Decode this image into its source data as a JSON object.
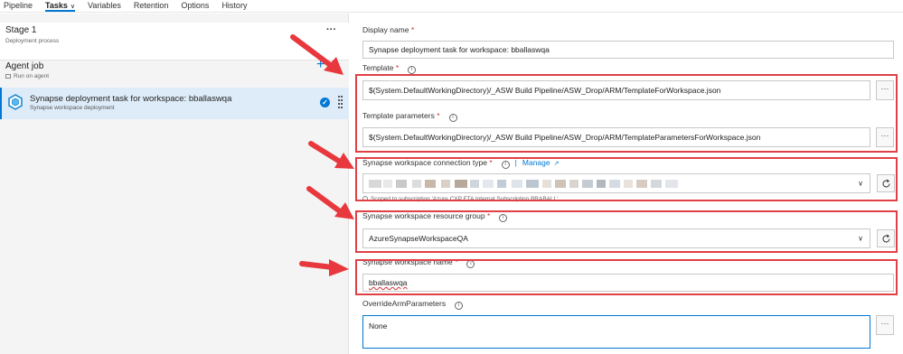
{
  "topnav": {
    "tabs": [
      {
        "label": "Pipeline"
      },
      {
        "label": "Tasks"
      },
      {
        "label": "Variables"
      },
      {
        "label": "Retention"
      },
      {
        "label": "Options"
      },
      {
        "label": "History"
      }
    ],
    "active_tab": "Tasks"
  },
  "left": {
    "stage": {
      "title": "Stage 1",
      "subtitle": "Deployment process",
      "more": "···"
    },
    "agent": {
      "title": "Agent job",
      "subtitle": "Run on agent",
      "add_icon": "plus-icon"
    },
    "task": {
      "title": "Synapse deployment task for workspace: bballaswqa",
      "subtitle": "Synapse workspace deployment",
      "status_icon": "check-circle-icon"
    }
  },
  "form": {
    "display_name": {
      "label": "Display name",
      "value": "Synapse deployment task for workspace: bballaswqa"
    },
    "template": {
      "label": "Template",
      "value": "$(System.DefaultWorkingDirectory)/_ASW Build Pipeline/ASW_Drop/ARM/TemplateForWorkspace.json",
      "more": "···"
    },
    "template_parameters": {
      "label": "Template parameters",
      "value": "$(System.DefaultWorkingDirectory)/_ASW Build Pipeline/ASW_Drop/ARM/TemplateParametersForWorkspace.json",
      "more": "···"
    },
    "connection_type": {
      "label": "Synapse workspace connection type",
      "manage": "Manage",
      "note": "Scoped to subscription 'Azure CXP FTA Internal Subscription BRABALL'"
    },
    "resource_group": {
      "label": "Synapse workspace resource group",
      "value": "AzureSynapseWorkspaceQA"
    },
    "workspace_name": {
      "label": "Synapse workspace name",
      "value": "bballaswqa"
    },
    "override": {
      "label": "OverrideArmParameters",
      "value": "None",
      "more": "···"
    },
    "required_mark": "*",
    "info_glyph": "i"
  },
  "colors": {
    "accent": "#0078d4",
    "highlight": "#e04046",
    "selected_bg": "#deecf9",
    "arrow": "#e8383d"
  }
}
